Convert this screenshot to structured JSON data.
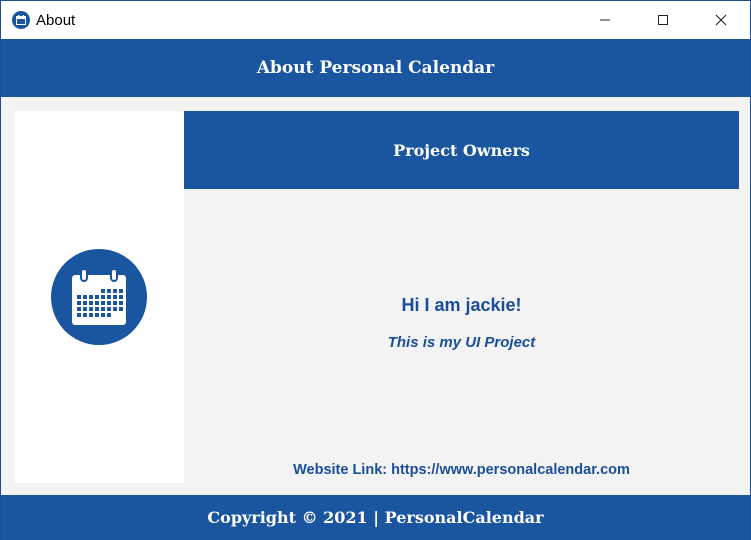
{
  "window": {
    "title": "About",
    "icon": "calendar-icon",
    "controls": [
      "minimize-icon",
      "maximize-icon",
      "close-icon"
    ]
  },
  "header": {
    "title": "About Personal Calendar"
  },
  "left_panel": {
    "icon": "calendar-icon"
  },
  "owners": {
    "title": "Project Owners"
  },
  "content": {
    "greeting": "Hi I am jackie!",
    "tagline": "This is my UI Project",
    "website": "Website Link: https://www.personalcalendar.com"
  },
  "footer": {
    "copyright": "Copyright © 2021  |  PersonalCalendar"
  },
  "colors": {
    "accent": "#1a56a0",
    "text_accent": "#1a4e9a",
    "background": "#f3f3f3",
    "panel": "#ffffff"
  }
}
